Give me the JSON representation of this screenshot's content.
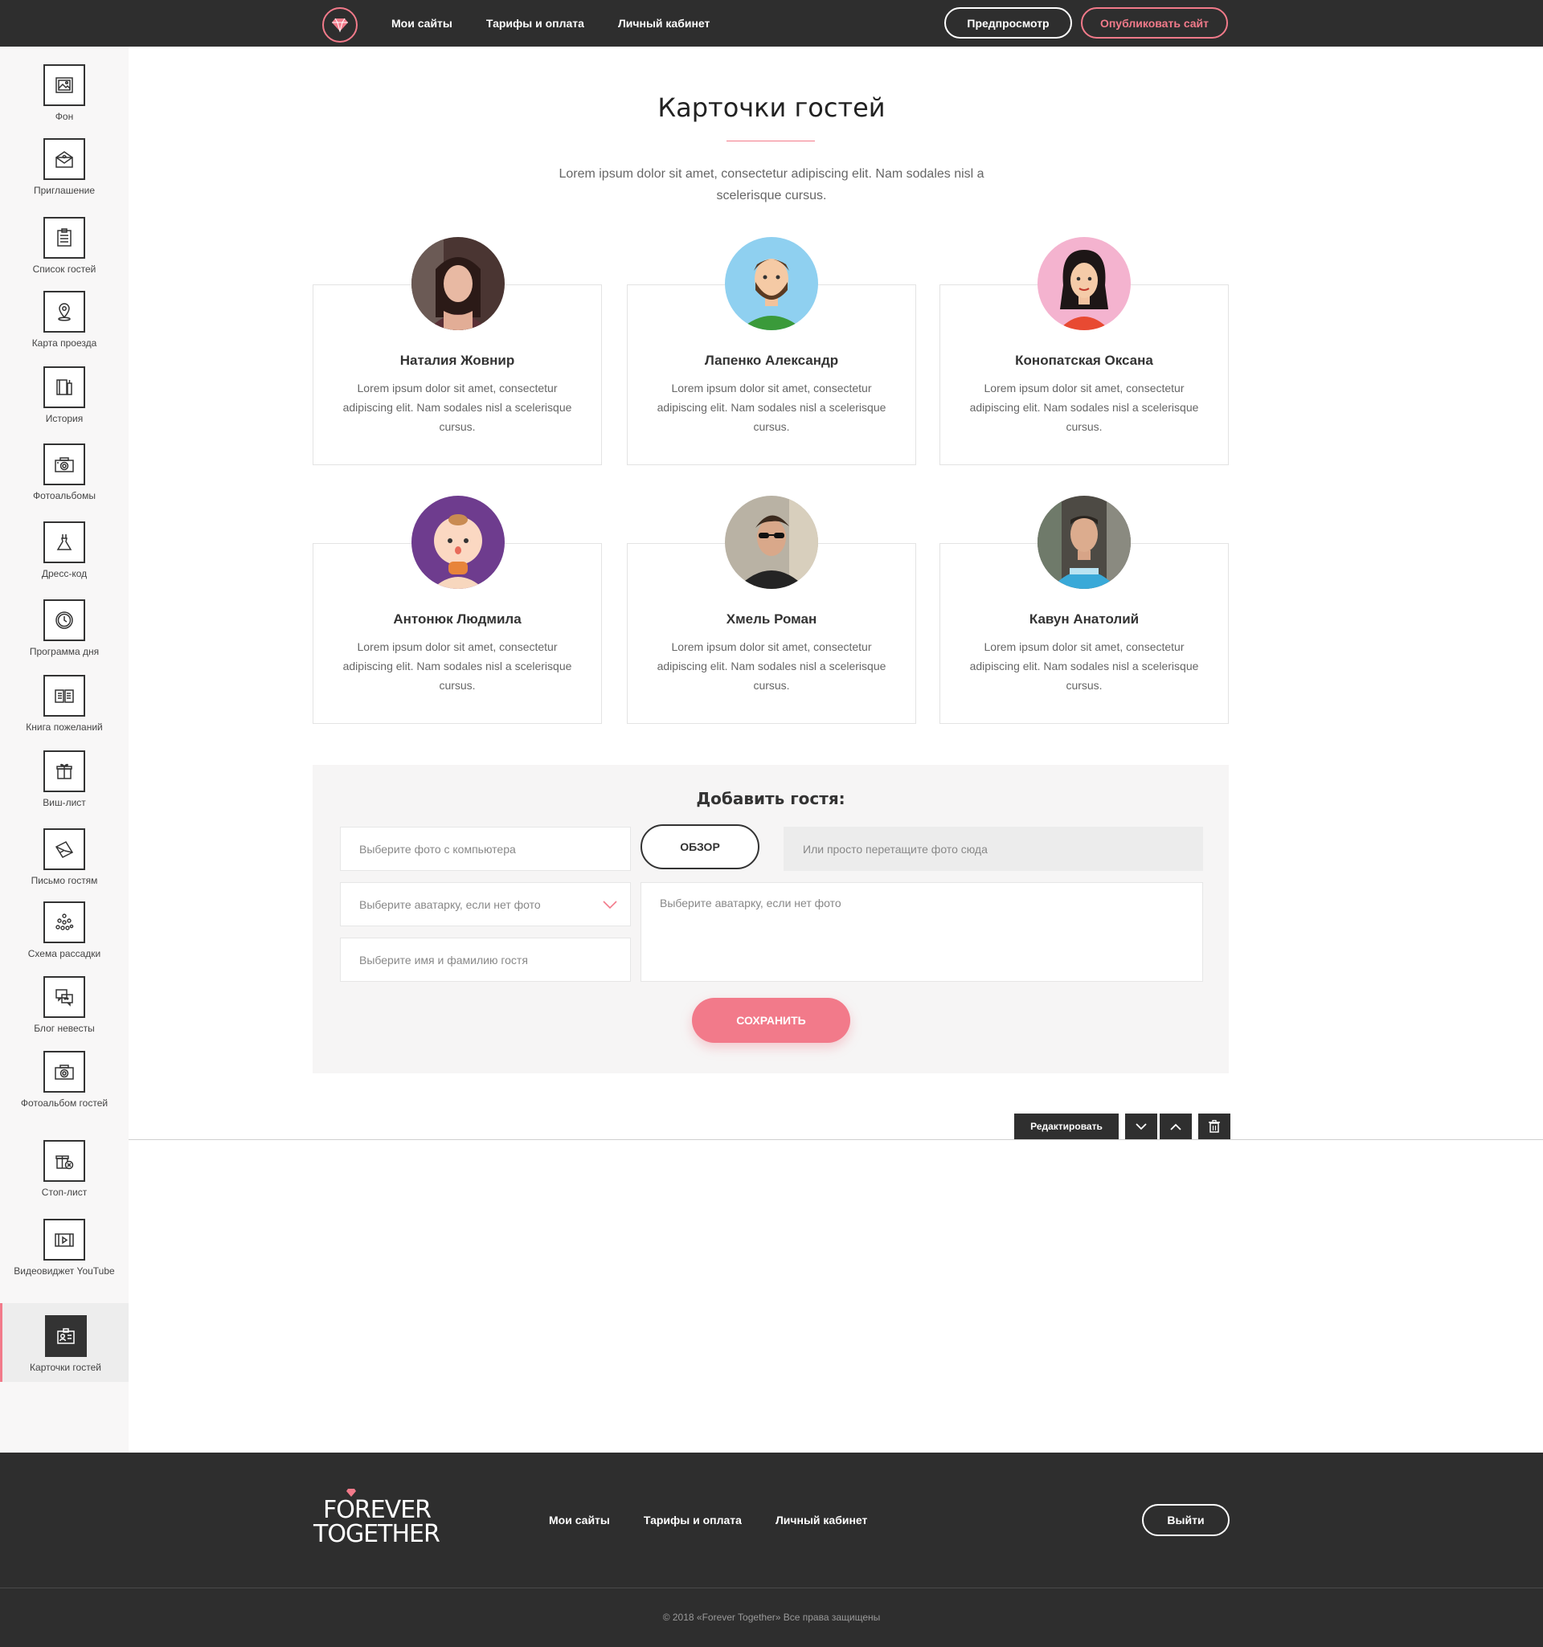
{
  "nav": {
    "links": [
      "Мои сайты",
      "Тарифы и оплата",
      "Личный кабинет"
    ],
    "preview_label": "Предпросмотр",
    "publish_label": "Опубликовать сайт"
  },
  "sidebar": {
    "items": [
      {
        "label": "Фон",
        "icon": "image-icon"
      },
      {
        "label": "Приглашение",
        "icon": "envelope-icon"
      },
      {
        "label": "Список гостей",
        "icon": "clipboard-icon"
      },
      {
        "label": "Карта проезда",
        "icon": "map-pin-icon"
      },
      {
        "label": "История",
        "icon": "book-icon"
      },
      {
        "label": "Фотоальбомы",
        "icon": "camera-icon"
      },
      {
        "label": "Дресс-код",
        "icon": "dress-icon"
      },
      {
        "label": "Программа дня",
        "icon": "clock-icon"
      },
      {
        "label": "Книга пожеланий",
        "icon": "open-book-icon"
      },
      {
        "label": "Виш-лист",
        "icon": "gift-icon"
      },
      {
        "label": "Письмо гостям",
        "icon": "letter-icon"
      },
      {
        "label": "Схема рассадки",
        "icon": "seating-icon"
      },
      {
        "label": "Блог невесты",
        "icon": "chat-icon"
      },
      {
        "label": "Фотоальбом гостей",
        "icon": "camera-icon"
      },
      {
        "label": "Стоп-лист",
        "icon": "gift-cancel-icon"
      },
      {
        "label": "Видеовиджет YouTube",
        "icon": "video-icon"
      },
      {
        "label": "Карточки гостей",
        "icon": "id-card-icon",
        "active": true
      }
    ]
  },
  "section": {
    "title": "Карточки гостей",
    "subtitle": "Lorem ipsum dolor sit amet, consectetur adipiscing elit. Nam sodales nisl a scelerisque cursus."
  },
  "guests": [
    {
      "name": "Наталия Жовнир",
      "text": "Lorem ipsum dolor sit amet, consectetur adipiscing elit. Nam sodales nisl a scelerisque cursus."
    },
    {
      "name": "Лапенко Александр",
      "text": "Lorem ipsum dolor sit amet, consectetur adipiscing elit. Nam sodales nisl a scelerisque cursus."
    },
    {
      "name": "Конопатская Оксана",
      "text": "Lorem ipsum dolor sit amet, consectetur adipiscing elit. Nam sodales nisl a scelerisque cursus."
    },
    {
      "name": "Антонюк Людмила",
      "text": "Lorem ipsum dolor sit amet, consectetur adipiscing elit. Nam sodales nisl a scelerisque cursus."
    },
    {
      "name": "Хмель Роман",
      "text": "Lorem ipsum dolor sit amet, consectetur adipiscing elit. Nam sodales nisl a scelerisque cursus."
    },
    {
      "name": "Кавун Анатолий",
      "text": "Lorem ipsum dolor sit amet, consectetur adipiscing elit. Nam sodales nisl a scelerisque cursus."
    }
  ],
  "form": {
    "title": "Добавить гостя:",
    "photo_placeholder": "Выберите фото с компьютера",
    "browse_label": "ОБЗОР",
    "drop_placeholder": "Или просто перетащите фото сюда",
    "avatar_select_placeholder": "Выберите аватарку, если нет фото",
    "avatar_text_placeholder": "Выберите аватарку, если нет фото",
    "name_placeholder": "Выберите имя и фамилию гостя",
    "save_label": "СОХРАНИТЬ"
  },
  "toolbar": {
    "edit_label": "Редактировать"
  },
  "footer": {
    "logo_line1": "FOREVER",
    "logo_line2": "TOGETHER",
    "links": [
      "Мои сайты",
      "Тарифы и оплата",
      "Личный кабинет"
    ],
    "logout_label": "Выйти",
    "copyright": "© 2018 «Forever Together» Все права защищены"
  },
  "colors": {
    "accent": "#f27a8a",
    "dark": "#2e2e2e"
  }
}
